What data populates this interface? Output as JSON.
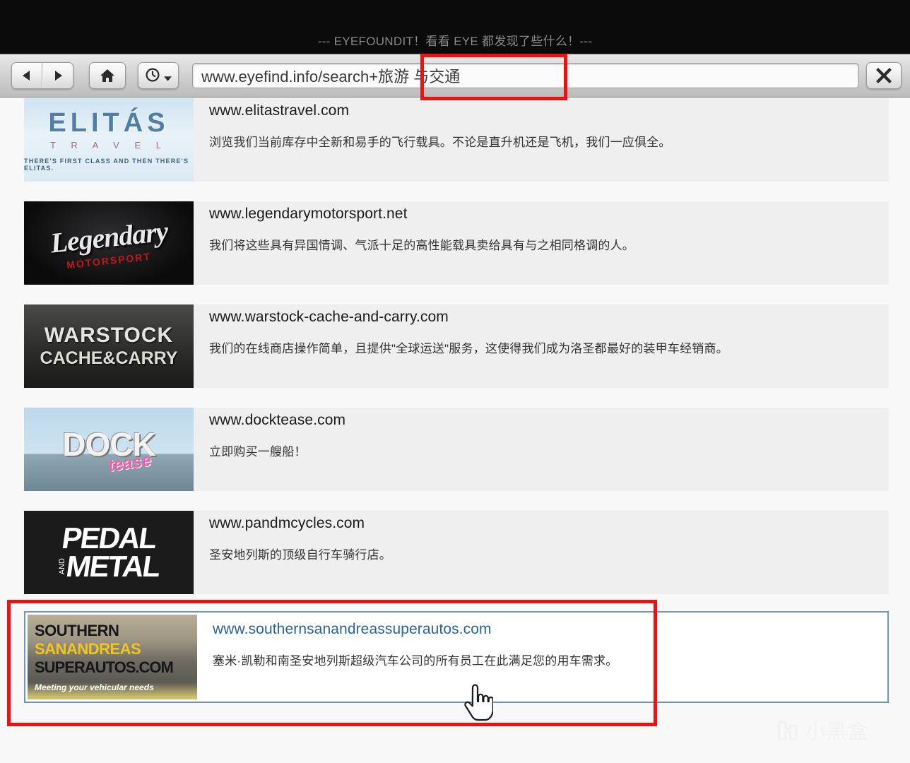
{
  "window": {
    "title": "--- EYEFOUNDIT！看看 EYE 都发现了些什么！---"
  },
  "toolbar": {
    "back_label": "◀",
    "forward_label": "▶",
    "home_label": "home-icon",
    "history_label": "history-clock-icon",
    "close_label": "✕",
    "url_value": "www.eyefind.info/search+旅游 与交通",
    "url_placeholder": "www.eyefind.info"
  },
  "results": [
    {
      "url": "www.elitastravel.com",
      "description": "浏览我们当前库存中全新和易手的飞行载具。不论是直升机还是飞机，我们一应俱全。",
      "logo": {
        "name": "elitas-travel-logo",
        "style": "elitas",
        "line1": "ELITÁS",
        "line2": "T R A V E L",
        "tagline": "THERE'S FIRST CLASS AND THEN THERE'S ELITAS."
      },
      "selected": false
    },
    {
      "url": "www.legendarymotorsport.net",
      "description": "我们将这些具有异国情调、气派十足的高性能载具卖给具有与之相同格调的人。",
      "logo": {
        "name": "legendary-motorsport-logo",
        "style": "legendary",
        "line1": "Legendary",
        "line2": "MOTORSPORT",
        "tagline": ""
      },
      "selected": false
    },
    {
      "url": "www.warstock-cache-and-carry.com",
      "description": "我们的在线商店操作简单，且提供\"全球运送\"服务，这使得我们成为洛圣都最好的装甲车经销商。",
      "logo": {
        "name": "warstock-cache-and-carry-logo",
        "style": "warstock",
        "line1": "WARSTOCK",
        "line2": "CACHE&CARRY",
        "tagline": ""
      },
      "selected": false
    },
    {
      "url": "www.docktease.com",
      "description": "立即购买一艘船！",
      "logo": {
        "name": "docktease-logo",
        "style": "dock",
        "line1": "DOCK",
        "line2": "tease",
        "tagline": ""
      },
      "selected": false
    },
    {
      "url": "www.pandmcycles.com",
      "description": "圣安地列斯的顶级自行车骑行店。",
      "logo": {
        "name": "pedal-and-metal-logo",
        "style": "pedal",
        "line1": "PEDAL",
        "line2": "METAL",
        "tagline": "AND"
      },
      "selected": false
    },
    {
      "url": "www.southernsanandreassuperautos.com",
      "description": "塞米·凯勒和南圣安地列斯超级汽车公司的所有员工在此满足您的用车需求。",
      "logo": {
        "name": "southern-san-andreas-super-autos-logo",
        "style": "ssa",
        "line1": "SOUTHERN",
        "line2": "SANANDREAS",
        "line3": "SUPERAUTOS.COM",
        "tagline": "Meeting your vehicular needs"
      },
      "selected": true
    }
  ],
  "annotations": {
    "url_box_color": "#ef1010",
    "result_box_color": "#ef1010",
    "selected_row_border_color": "#6f96b3"
  },
  "cursor": {
    "type": "pointing-hand"
  },
  "watermark": {
    "text": "小黑盒"
  }
}
